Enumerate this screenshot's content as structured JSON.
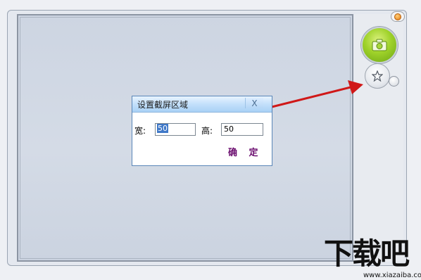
{
  "dialog": {
    "title": "设置截屏区域",
    "close_label": "X",
    "width_label": "宽:",
    "width_value": "50",
    "height_label": "高:",
    "height_value": "50",
    "ok_label": "确 定"
  },
  "sidebar": {
    "camera_icon": "camera-icon",
    "star_icon": "star-icon"
  },
  "watermark": {
    "logo_text": "下载吧",
    "url": "www.xiazaiba.com"
  },
  "colors": {
    "arrow": "#d01818",
    "camera_green": "#9fd22a",
    "ok_text": "#6a0c6e"
  }
}
